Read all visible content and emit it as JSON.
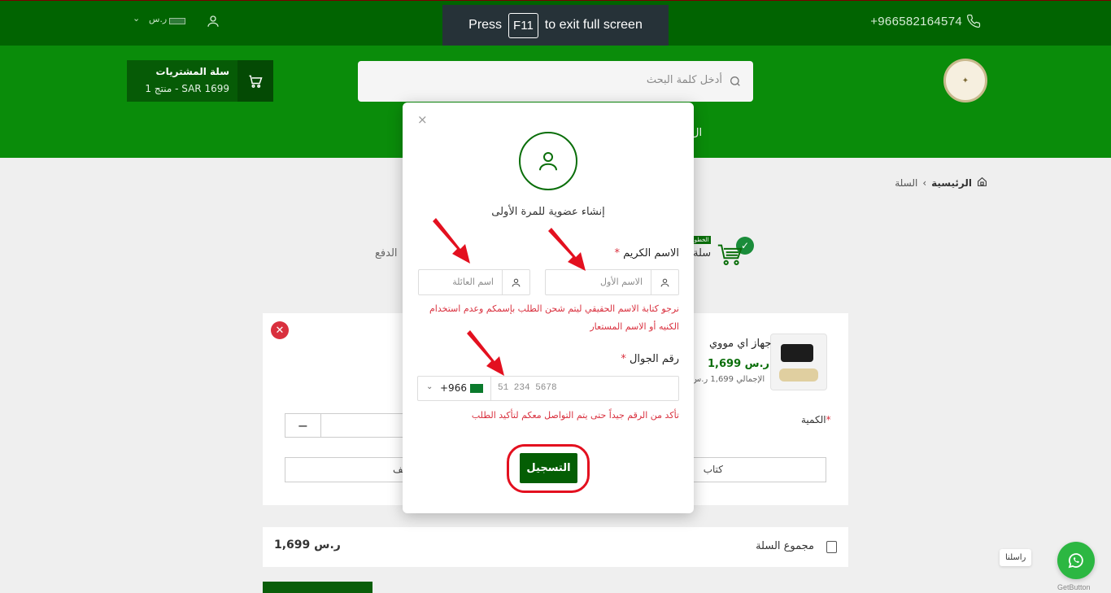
{
  "topbar": {
    "phone": "+966582164574",
    "currency": "ر.س",
    "icons": [
      "phone-icon",
      "user-icon",
      "chevron-down-icon"
    ]
  },
  "fullscreen_notice": {
    "press": "Press",
    "key": "F11",
    "rest": "to exit full screen"
  },
  "header": {
    "search_placeholder": "أدخل كلمة البحث",
    "cart_title": "سلة المشتريات",
    "cart_summary": "1 منتج - SAR 1699",
    "nav_fragment": "ال"
  },
  "breadcrumb": {
    "home": "الرئيسية",
    "current": "السلة"
  },
  "steps": {
    "badge": "الخطوة",
    "cart_label": "سلة",
    "payment_label": "الدفع"
  },
  "cart_item": {
    "name": "جهاز اي مووي",
    "price": "1,699 ر.س",
    "total": "الإجمالي 1,699 ر.س",
    "quantity_label": "الكمية",
    "quantity_required": "*",
    "minus": "−",
    "note_right": "كتاب",
    "note_left": "لف"
  },
  "totals": {
    "label": "مجموع السلة",
    "amount": "1,699 ر.س"
  },
  "whatsapp": {
    "label": "راسلنا",
    "brand": "GetButton"
  },
  "modal": {
    "close": "×",
    "heading": "إنشاء عضوية للمرة الأولى",
    "name_label": "الاسم الكريم",
    "required_mark": "*",
    "first_name_placeholder": "الاسم الأول",
    "last_name_placeholder": "اسم العائلة",
    "name_hint": "نرجو كتابة الاسم الحقيقي ليتم شحن الطلب بإسمكم وعدم استخدام الكنيه أو الاسم المستعار",
    "phone_label": "رقم الجوال",
    "phone_placeholder": "51 234 5678",
    "country_code": "+966",
    "phone_hint": "تأكد من الرقم جيداً حتى يتم التواصل معكم لتأكيد الطلب",
    "submit": "التسجيل"
  },
  "colors": {
    "topbar": "#016401",
    "header": "#0a8c0a",
    "button": "#045e04",
    "alert": "#d9303e",
    "annotation_red": "#e3101f"
  }
}
